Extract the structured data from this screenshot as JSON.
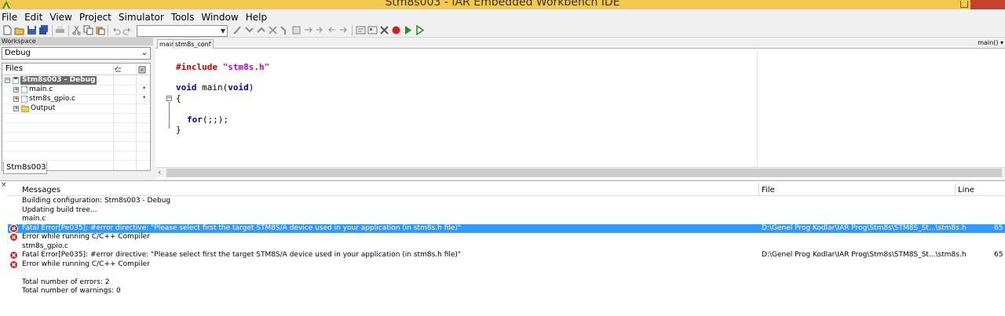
{
  "window": {
    "title": "Stm8s003 - IAR Embedded Workbench IDE"
  },
  "menu": [
    "File",
    "Edit",
    "View",
    "Project",
    "Simulator",
    "Tools",
    "Window",
    "Help"
  ],
  "toolbar": {
    "config_combo_value": ""
  },
  "workspace": {
    "header": "Workspace",
    "configuration": "Debug",
    "columns": {
      "files": "Files"
    },
    "tree": [
      {
        "label": "Stm8s003 - Debug",
        "check": "✔",
        "selected": true
      },
      {
        "label": "main.c",
        "mark": "•"
      },
      {
        "label": "stm8s_gpio.c",
        "mark": "•"
      },
      {
        "label": "Output"
      }
    ],
    "bottom_tab": "Stm8s003"
  },
  "editor": {
    "tabs": [
      "main",
      "stm8s_conf"
    ],
    "function_selector": "main()",
    "code": {
      "l1_directive": "#include",
      "l1_string": "\"stm8s.h\"",
      "l2_kw1": "void",
      "l2_name": " main(",
      "l2_kw2": "void",
      "l2_end": ")",
      "l3": "{",
      "l4_kw": "for",
      "l4_rest": "(;;);",
      "l5": "}"
    }
  },
  "messages": {
    "columns": {
      "messages": "Messages",
      "file": "File",
      "line": "Line"
    },
    "rows": [
      {
        "text": "Building configuration: Stm8s003 - Debug",
        "file": "",
        "line": "",
        "error": false
      },
      {
        "text": "Updating build tree...",
        "file": "",
        "line": "",
        "error": false
      },
      {
        "text": "main.c",
        "file": "",
        "line": "",
        "error": false
      },
      {
        "text": "Fatal Error[Pe035]: #error directive: \"Please select first the target STM8S/A device used in your application (in stm8s.h file)\"",
        "file": "D:\\Genel Prog Kodlar\\IAR Prog\\Stm8s\\STM8S_St...\\stm8s.h",
        "line": "65",
        "error": true,
        "selected": true
      },
      {
        "text": "Error while running C/C++ Compiler",
        "file": "",
        "line": "",
        "error": true
      },
      {
        "text": "stm8s_gpio.c",
        "file": "",
        "line": "",
        "error": false
      },
      {
        "text": "Fatal Error[Pe035]: #error directive: \"Please select first the target STM8S/A device used in your application (in stm8s.h file)\"",
        "file": "D:\\Genel Prog Kodlar\\IAR Prog\\Stm8s\\STM8S_St...\\stm8s.h",
        "line": "65",
        "error": true
      },
      {
        "text": "Error while running C/C++ Compiler",
        "file": "",
        "line": "",
        "error": true
      },
      {
        "text": "",
        "file": "",
        "line": "",
        "error": false
      },
      {
        "text": "Total number of errors: 2",
        "file": "",
        "line": "",
        "error": false
      },
      {
        "text": "Total number of warnings: 0",
        "file": "",
        "line": "",
        "error": false
      }
    ]
  },
  "colors": {
    "title_bar": "#f2c94c",
    "selection": "#3399ff",
    "error_icon": "#d32020"
  }
}
